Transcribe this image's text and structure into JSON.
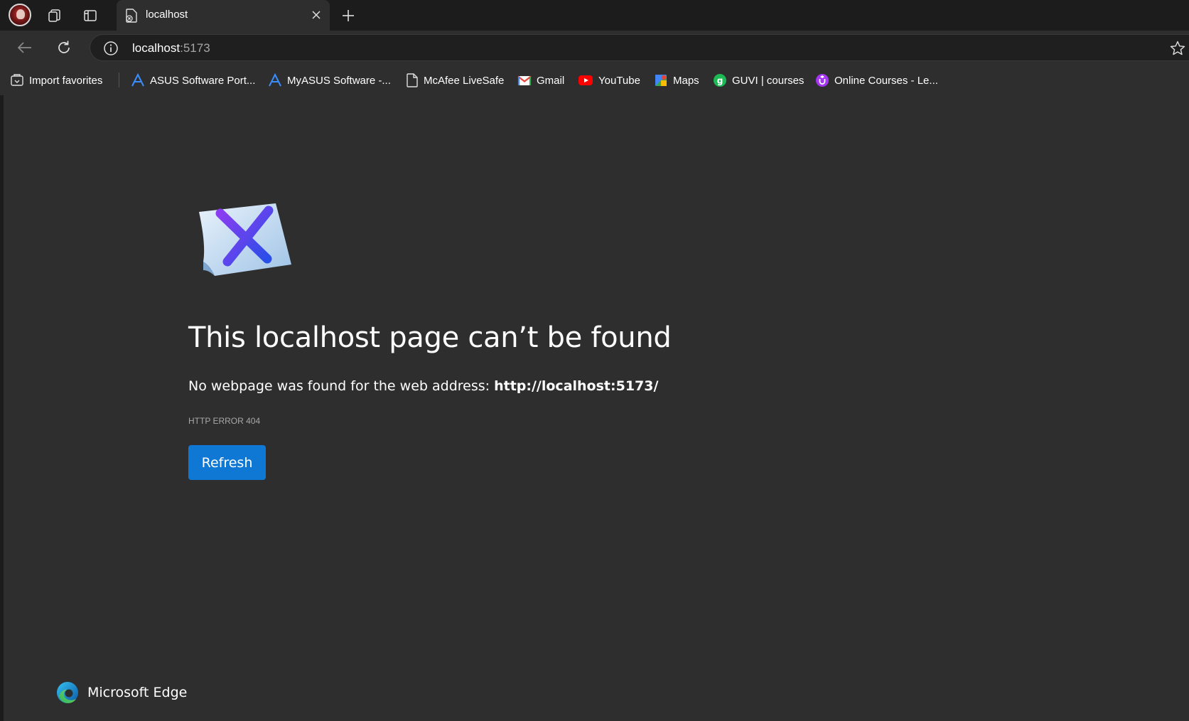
{
  "tabstrip": {
    "tab_title": "localhost"
  },
  "toolbar": {
    "address_host": "localhost",
    "address_port": ":5173"
  },
  "favorites": [
    {
      "label": "Import favorites",
      "icon": "import-icon"
    },
    {
      "label": "ASUS Software Port...",
      "icon": "asus-icon"
    },
    {
      "label": "MyASUS Software -...",
      "icon": "asus-icon"
    },
    {
      "label": "McAfee LiveSafe",
      "icon": "page-icon"
    },
    {
      "label": "Gmail",
      "icon": "gmail-icon"
    },
    {
      "label": "YouTube",
      "icon": "youtube-icon"
    },
    {
      "label": "Maps",
      "icon": "maps-icon"
    },
    {
      "label": "GUVI | courses",
      "icon": "guvi-icon"
    },
    {
      "label": "Online Courses - Le...",
      "icon": "udemy-icon"
    }
  ],
  "error": {
    "title": "This localhost page can’t be found",
    "description_prefix": "No webpage was found for the web address: ",
    "description_url": "http://localhost:5173/",
    "code": "HTTP ERROR 404",
    "refresh_label": "Refresh"
  },
  "footer": {
    "brand": "Microsoft Edge"
  },
  "colors": {
    "accent": "#0f78d4",
    "page_bg": "#2e2e2e",
    "frame_bg": "#1c1c1c"
  }
}
